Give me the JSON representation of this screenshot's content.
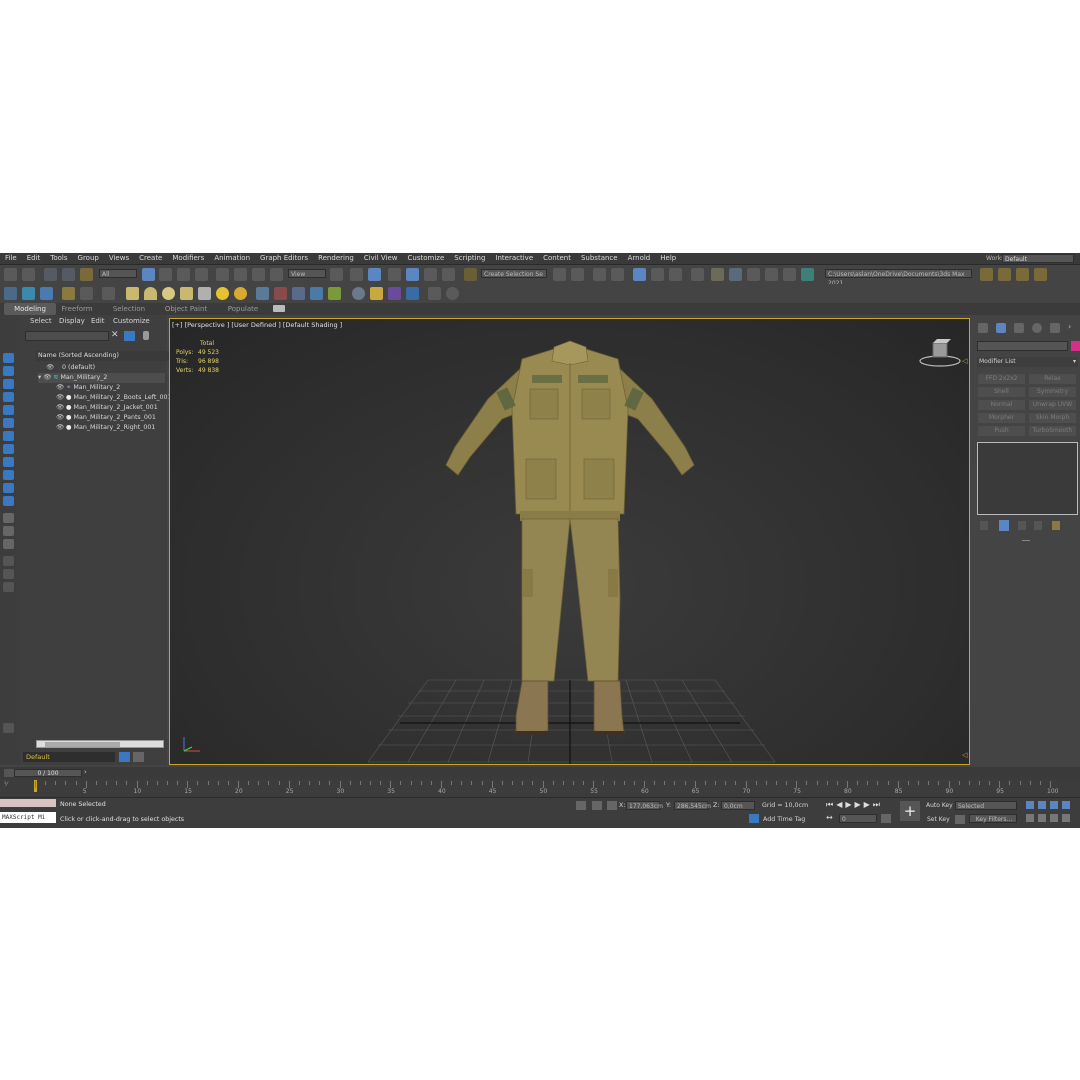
{
  "menu": [
    "File",
    "Edit",
    "Tools",
    "Group",
    "Views",
    "Create",
    "Modifiers",
    "Animation",
    "Graph Editors",
    "Rendering",
    "Civil View",
    "Customize",
    "Scripting",
    "Interactive",
    "Content",
    "Substance",
    "Arnold",
    "Help"
  ],
  "workspaces": {
    "label": "Workspaces:",
    "value": "Default"
  },
  "toolbar": {
    "filter_value": "All",
    "refcoord_value": "View",
    "selection_set": "Create Selection Se",
    "path": "C:\\Users\\aslan\\OneDrive\\Documents\\3ds Max 2021"
  },
  "ribbon_tabs": [
    "Modeling",
    "Freeform",
    "Selection",
    "Object Paint",
    "Populate"
  ],
  "explorer": {
    "menu": [
      "Select",
      "Display",
      "Edit",
      "Customize"
    ],
    "header": "Name (Sorted Ascending)",
    "rows": [
      {
        "label": "0 (default)"
      },
      {
        "label": "Man_Military_2"
      },
      {
        "label": "Man_Military_2"
      },
      {
        "label": "Man_Military_2_Boots_Left_001"
      },
      {
        "label": "Man_Military_2_Jacket_001"
      },
      {
        "label": "Man_Military_2_Pants_001"
      },
      {
        "label": "Man_Military_2_Right_001"
      }
    ],
    "layer": "Default"
  },
  "viewport": {
    "label": "[+] [Perspective ] [User Defined ] [Default Shading ]",
    "stats": {
      "header": "Total",
      "polys_label": "Polys:",
      "polys": "49 523",
      "tris_label": "Tris:",
      "tris": "96 898",
      "verts_label": "Verts:",
      "verts": "49 838"
    }
  },
  "command_panel": {
    "modifier_list": "Modifier List",
    "buttons": [
      "FFD 2x2x2",
      "Relax",
      "Shell",
      "Symmetry",
      "Normal",
      "Unwrap UVW",
      "Morpher",
      "Skin Morph",
      "Push",
      "TurboSmooth"
    ],
    "color": "#d4308a"
  },
  "timeline": {
    "frame": "0 / 100",
    "frame_progress": 0,
    "ticks": [
      "5",
      "10",
      "15",
      "20",
      "25",
      "30",
      "35",
      "40",
      "45",
      "50",
      "55",
      "60",
      "65",
      "70",
      "75",
      "80",
      "85",
      "90",
      "95",
      "100"
    ]
  },
  "status": {
    "maxscript": "MAXScript Mi",
    "selected": "None Selected",
    "prompt": "Click or click-and-drag to select objects",
    "x_label": "X:",
    "x": "177,063cm",
    "y_label": "Y:",
    "y": "286,545cm",
    "z_label": "Z:",
    "z": "0,0cm",
    "grid": "Grid = 10,0cm",
    "add_time_tag": "Add Time Tag",
    "auto_key": "Auto Key",
    "set_key": "Set Key",
    "selected_dd": "Selected",
    "key_filters": "Key Filters...",
    "frame_field": "0"
  }
}
